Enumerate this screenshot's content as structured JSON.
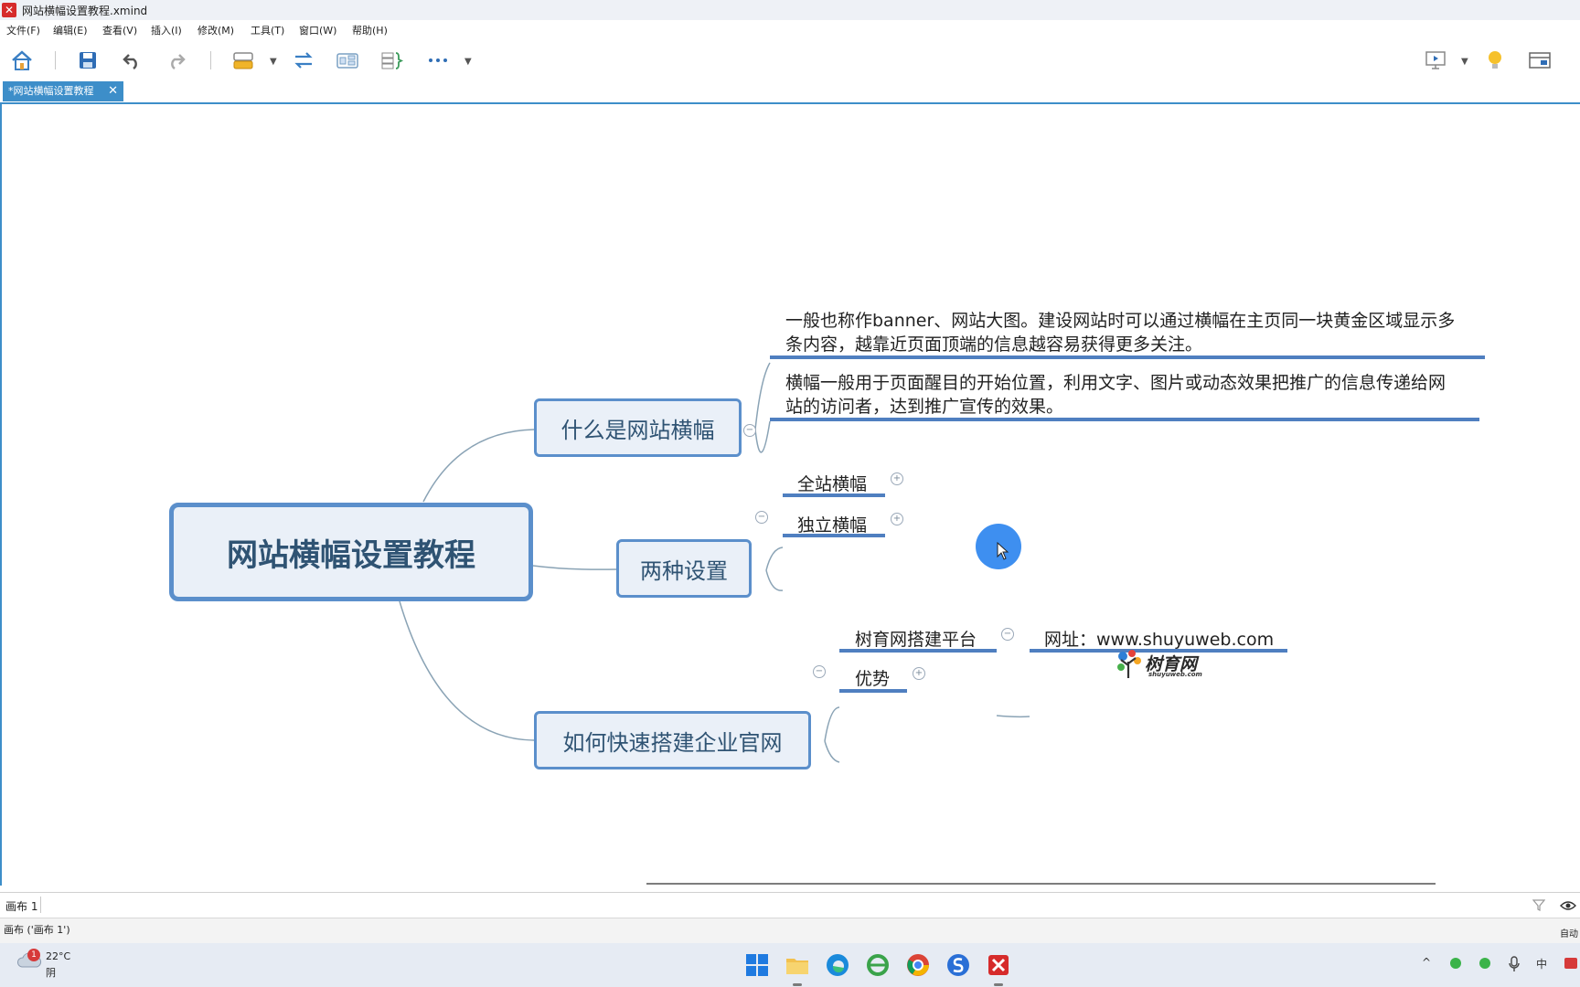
{
  "window": {
    "title": "网站横幅设置教程.xmind"
  },
  "menu": [
    "文件(F)",
    "编辑(E)",
    "查看(V)",
    "插入(I)",
    "修改(M)",
    "工具(T)",
    "窗口(W)",
    "帮助(H)"
  ],
  "tab": {
    "label": "*网站横幅设置教程",
    "close": "✕"
  },
  "mindmap": {
    "central": "网站横幅设置教程",
    "topic1": {
      "label": "什么是网站横幅",
      "para1_line1": "一般也称作banner、网站大图。建设网站时可以通过横幅在主页同一块黄金区域显示多",
      "para1_line2": "条内容，越靠近页面顶端的信息越容易获得更多关注。",
      "para2_line1": "横幅一般用于页面醒目的开始位置，利用文字、图片或动态效果把推广的信息传递给网",
      "para2_line2": "站的访问者，达到推广宣传的效果。"
    },
    "topic2": {
      "label": "两种设置",
      "sub1": "全站横幅",
      "sub2": "独立横幅"
    },
    "topic3": {
      "label": "如何快速搭建企业官网",
      "sub1": "树育网搭建平台",
      "sub1_child": "网址：www.shuyuweb.com",
      "sub2": "优势"
    },
    "logo": {
      "name": "树育网",
      "sub": "shuyuweb.com"
    }
  },
  "fold": {
    "collapse": "−",
    "expand": "+"
  },
  "sheetbar": {
    "label": "画布 1"
  },
  "status": {
    "left": "画布 ('画布 1')",
    "right": "自动"
  },
  "taskbar": {
    "badge": "1",
    "temp": "22°C",
    "condition": "阴",
    "ime": "中"
  }
}
